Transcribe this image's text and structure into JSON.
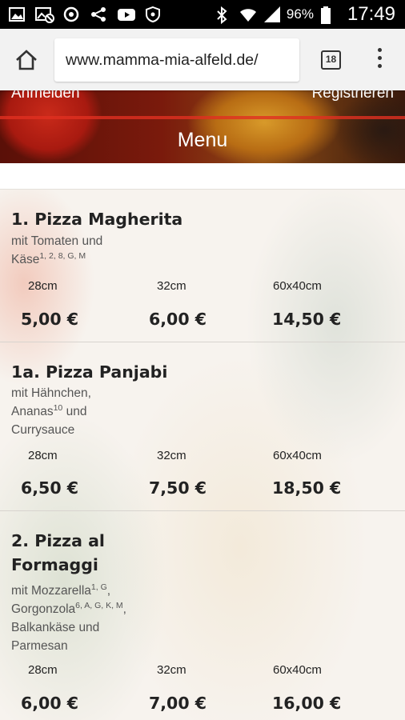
{
  "status_bar": {
    "icons": [
      "image-icon",
      "photo-off-icon",
      "sync-icon",
      "share-icon",
      "youtube-icon",
      "shield-icon"
    ],
    "battery_percent": "96%",
    "time": "17:49"
  },
  "browser": {
    "url": "www.mamma-mia-alfeld.de/",
    "tab_count": "18"
  },
  "header": {
    "login_label": "Anmelden",
    "register_label": "Registrieren",
    "title": "Menu"
  },
  "menu_items": [
    {
      "title": "1. Pizza Magherita",
      "desc_parts": [
        "mit Tomaten und Käse"
      ],
      "desc_sup": [
        "1, 2, 8, G, M"
      ],
      "sizes": [
        "28cm",
        "32cm",
        "60x40cm"
      ],
      "prices": [
        "5,00 €",
        "6,00 €",
        "14,50 €"
      ]
    },
    {
      "title": "1a. Pizza Panjabi",
      "desc_parts": [
        "mit Hähnchen, Ananas",
        " und Currysauce"
      ],
      "desc_sup": [
        "10"
      ],
      "sizes": [
        "28cm",
        "32cm",
        "60x40cm"
      ],
      "prices": [
        "6,50 €",
        "7,50 €",
        "18,50 €"
      ]
    },
    {
      "title": "2. Pizza al Formaggi",
      "desc_parts": [
        "mit Mozzarella",
        ", Gorgonzola",
        ", Balkankäse und Parmesan"
      ],
      "desc_sup": [
        "1, G",
        "6, A, G, K, M"
      ],
      "sizes": [
        "28cm",
        "32cm",
        "60x40cm"
      ],
      "prices": [
        "6,00 €",
        "7,00 €",
        "16,00 €"
      ]
    }
  ]
}
